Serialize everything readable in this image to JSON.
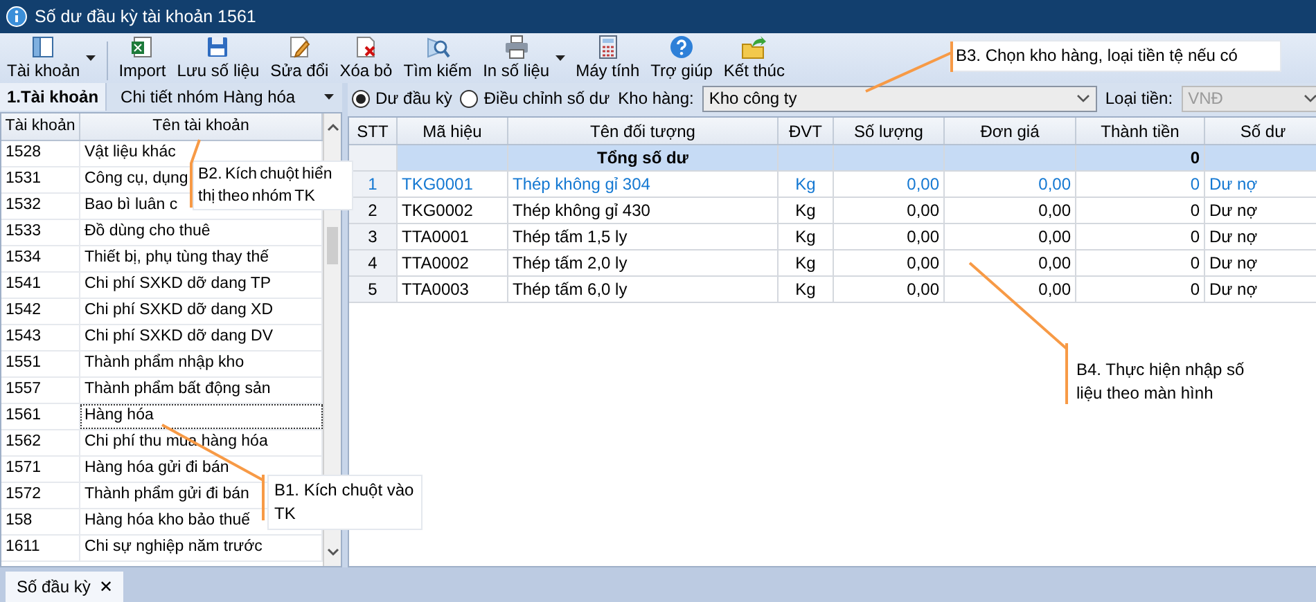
{
  "window": {
    "title": "Số dư đầu kỳ tài khoản 1561"
  },
  "toolbar": [
    {
      "label": "Tài khoản",
      "dropdown": true
    },
    {
      "label": "Import",
      "dropdown": false
    },
    {
      "label": "Lưu số liệu",
      "dropdown": false
    },
    {
      "label": "Sửa đổi",
      "dropdown": false
    },
    {
      "label": "Xóa bỏ",
      "dropdown": false
    },
    {
      "label": "Tìm kiếm",
      "dropdown": false
    },
    {
      "label": "In số liệu",
      "dropdown": true
    },
    {
      "label": "Máy tính",
      "dropdown": false
    },
    {
      "label": "Trợ giúp",
      "dropdown": false
    },
    {
      "label": "Kết thúc",
      "dropdown": false
    }
  ],
  "left_panel": {
    "tabs": [
      {
        "label": "1.Tài khoản",
        "selected": true
      }
    ],
    "group_filter": "Chi tiết nhóm Hàng hóa",
    "columns": [
      "Tài khoản",
      "Tên tài khoản"
    ],
    "rows": [
      {
        "account": "1528",
        "name": "Vật liệu khác",
        "selected": false
      },
      {
        "account": "1531",
        "name": "Công cụ, dụng",
        "selected": false
      },
      {
        "account": "1532",
        "name": "Bao bì luân c",
        "selected": false
      },
      {
        "account": "1533",
        "name": "Đồ dùng cho thuê",
        "selected": false
      },
      {
        "account": "1534",
        "name": "Thiết bị, phụ tùng thay thế",
        "selected": false
      },
      {
        "account": "1541",
        "name": "Chi phí SXKD dỡ dang TP",
        "selected": false
      },
      {
        "account": "1542",
        "name": "Chi phí SXKD dỡ dang XD",
        "selected": false
      },
      {
        "account": "1543",
        "name": "Chi phí SXKD dỡ dang DV",
        "selected": false
      },
      {
        "account": "1551",
        "name": "Thành phẩm nhập kho",
        "selected": false
      },
      {
        "account": "1557",
        "name": "Thành phẩm bất động sản",
        "selected": false
      },
      {
        "account": "1561",
        "name": "Hàng hóa",
        "selected": true
      },
      {
        "account": "1562",
        "name": "Chi phí thu mua hàng hóa",
        "selected": false
      },
      {
        "account": "1571",
        "name": "Hàng hóa gửi đi bán",
        "selected": false
      },
      {
        "account": "1572",
        "name": "Thành phẩm gửi đi bán",
        "selected": false
      },
      {
        "account": "158",
        "name": "Hàng hóa kho bảo thuế",
        "selected": false
      },
      {
        "account": "1611",
        "name": "Chi sự nghiệp năm trước",
        "selected": false
      }
    ]
  },
  "options": {
    "modes": [
      {
        "label": "Dư đầu kỳ",
        "selected": true
      },
      {
        "label": "Điều chỉnh số dư",
        "selected": false
      }
    ],
    "warehouse_label": "Kho hàng:",
    "warehouse": "Kho công ty",
    "currency_label": "Loại tiền:",
    "currency": "VNĐ",
    "currency_disabled": true
  },
  "table": {
    "columns": [
      "STT",
      "Mã hiệu",
      "Tên đối tượng",
      "ĐVT",
      "Số lượng",
      "Đơn giá",
      "Thành tiền",
      "Số dư"
    ],
    "total_label": "Tổng số dư",
    "total_amount": "0",
    "rows": [
      {
        "stt": "1",
        "code": "TKG0001",
        "name": "Thép không gỉ 304",
        "unit": "Kg",
        "qty": "0,00",
        "price": "0,00",
        "amount": "0",
        "balance": "Dư nợ",
        "selected": true
      },
      {
        "stt": "2",
        "code": "TKG0002",
        "name": "Thép không gỉ 430",
        "unit": "Kg",
        "qty": "0,00",
        "price": "0,00",
        "amount": "0",
        "balance": "Dư nợ",
        "selected": false
      },
      {
        "stt": "3",
        "code": "TTA0001",
        "name": "Thép tấm 1,5 ly",
        "unit": "Kg",
        "qty": "0,00",
        "price": "0,00",
        "amount": "0",
        "balance": "Dư nợ",
        "selected": false
      },
      {
        "stt": "4",
        "code": "TTA0002",
        "name": "Thép tấm 2,0 ly",
        "unit": "Kg",
        "qty": "0,00",
        "price": "0,00",
        "amount": "0",
        "balance": "Dư nợ",
        "selected": false
      },
      {
        "stt": "5",
        "code": "TTA0003",
        "name": "Thép tấm 6,0 ly",
        "unit": "Kg",
        "qty": "0,00",
        "price": "0,00",
        "amount": "0",
        "balance": "Dư nợ",
        "selected": false
      }
    ]
  },
  "callouts": [
    {
      "text": "B3. Chọn kho hàng, loại  tiền tệ nếu có",
      "boxed": true
    },
    {
      "text": "B2. Kích chuột hiển thị theo nhóm  TK",
      "boxed": true
    },
    {
      "text": "B1. Kích chuột vào TK",
      "boxed": true
    },
    {
      "text": "B4. Thực hiện nhập số liệu theo màn hình",
      "boxed": false
    }
  ],
  "bottom_tabs": [
    {
      "label": "Số đầu kỳ",
      "close": "✕",
      "selected": true
    }
  ]
}
